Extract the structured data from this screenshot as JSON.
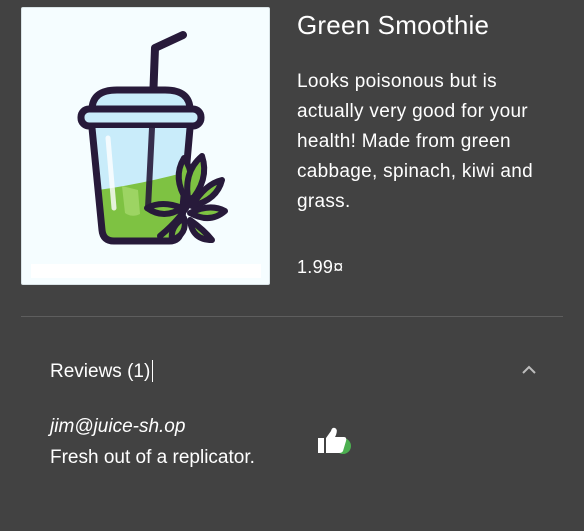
{
  "product": {
    "title": "Green Smoothie",
    "description": "Looks poisonous but is actually very good for your health! Made from green cabbage, spinach, kiwi and grass.",
    "price": "1.99¤",
    "image_icon": "smoothie-cup-icon"
  },
  "reviews": {
    "header_label": "Reviews (1)",
    "expanded": true,
    "items": [
      {
        "author": "jim@juice-sh.op",
        "text": "Fresh out of a replicator.",
        "like_icon": "thumbs-up-icon"
      }
    ]
  },
  "colors": {
    "background": "#424242",
    "image_background": "#f5fdff",
    "cup_outline": "#271a3a",
    "smoothie_green": "#7ec242",
    "cup_glass": "#c9ecfa",
    "like_badge": "#4caf50"
  }
}
